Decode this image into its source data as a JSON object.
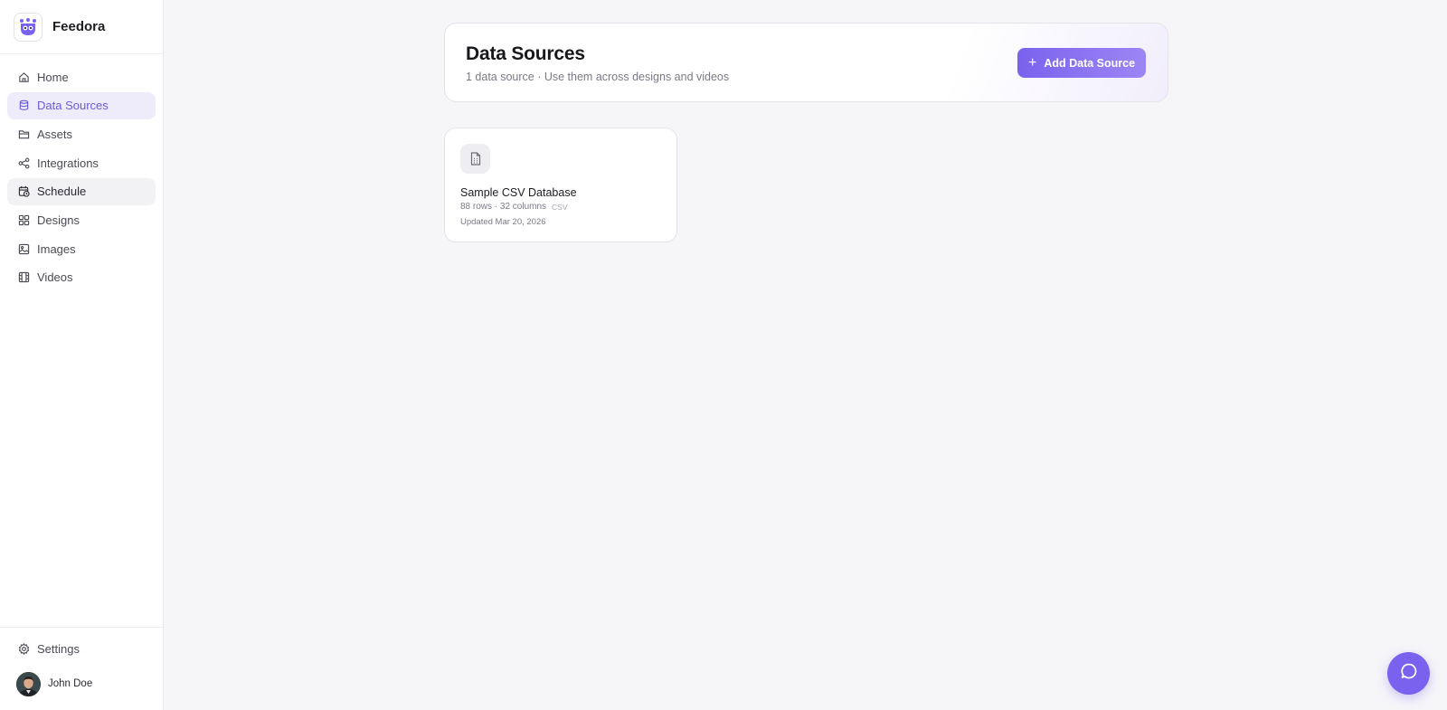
{
  "brand": {
    "name": "Feedora"
  },
  "sidebar": {
    "items": [
      {
        "label": "Home",
        "icon": "home-icon"
      },
      {
        "label": "Data Sources",
        "icon": "database-icon",
        "state": "active"
      },
      {
        "label": "Assets",
        "icon": "folder-icon"
      },
      {
        "label": "Integrations",
        "icon": "share-nodes-icon"
      },
      {
        "label": "Schedule",
        "icon": "calendar-clock-icon",
        "state": "hover"
      },
      {
        "label": "Designs",
        "icon": "grid-icon"
      },
      {
        "label": "Images",
        "icon": "image-icon"
      },
      {
        "label": "Videos",
        "icon": "film-icon"
      }
    ],
    "settings_label": "Settings",
    "user": {
      "name": "John Doe"
    }
  },
  "header": {
    "title": "Data Sources",
    "subtitle": "1 data source · Use them across designs and videos",
    "add_button_label": "Add Data Source"
  },
  "data_sources": [
    {
      "name": "Sample CSV Database",
      "meta": "88 rows · 32 columns",
      "tag": "CSV",
      "updated": "Updated Mar 20, 2026"
    }
  ],
  "colors": {
    "accent": "#7b62ee",
    "active_bg": "#eeecfb",
    "active_text": "#6b5bd6",
    "page_bg": "#f6f6f9"
  }
}
